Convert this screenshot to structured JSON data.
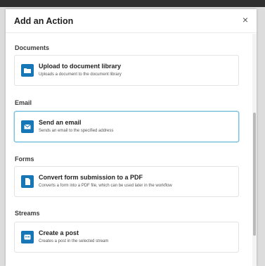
{
  "modal": {
    "title": "Add an Action",
    "close_label": "×"
  },
  "sections": [
    {
      "label": "Documents",
      "card": {
        "title": "Upload to document library",
        "description": "Uploads a document to the document library",
        "icon": "folder-icon"
      }
    },
    {
      "label": "Email",
      "card": {
        "title": "Send an email",
        "description": "Sends an email to the specified address",
        "icon": "envelope-icon",
        "selected": true
      }
    },
    {
      "label": "Forms",
      "card": {
        "title": "Convert form submission to a PDF",
        "description": "Converts a form into a PDF file, which can be used later in the workflow",
        "icon": "document-icon"
      }
    },
    {
      "label": "Streams",
      "card": {
        "title": "Create a post",
        "description": "Creates a post in the selected stream",
        "icon": "post-icon"
      }
    }
  ],
  "colors": {
    "icon_bg": "#1676b6",
    "selected_border": "#7cc3dd"
  }
}
